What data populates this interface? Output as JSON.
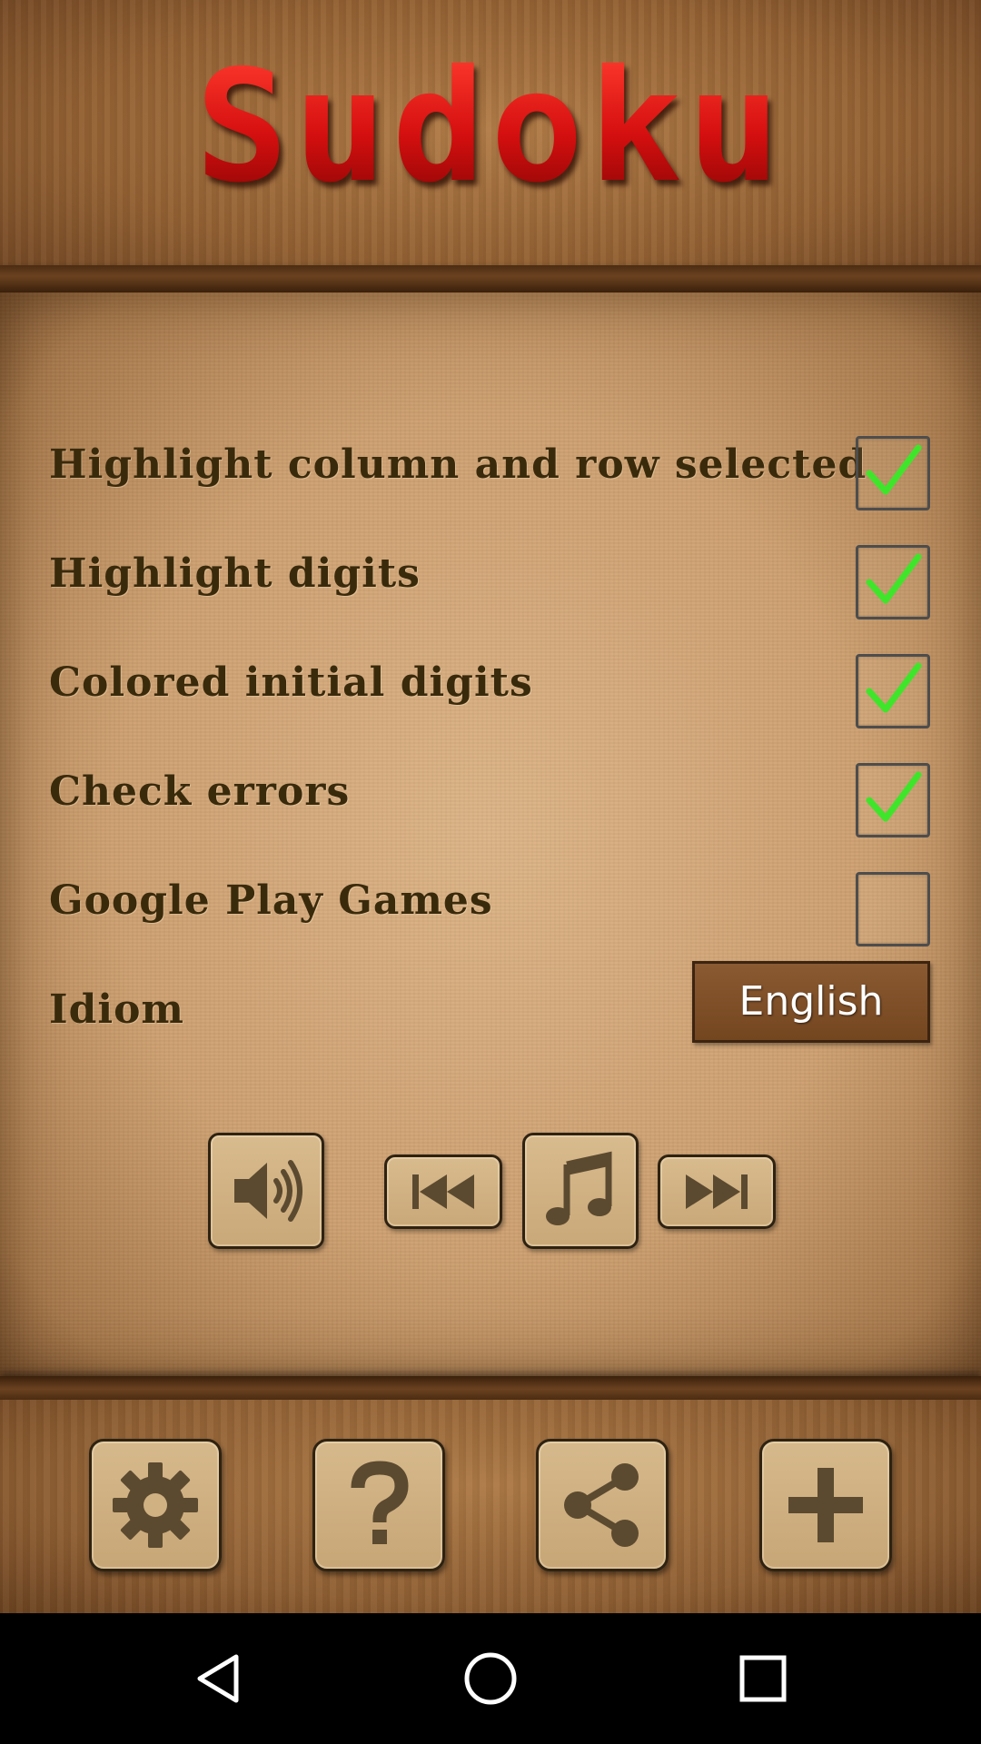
{
  "app": {
    "title": "Sudoku"
  },
  "settings": [
    {
      "label": "Highlight column and row selected",
      "checked": true
    },
    {
      "label": "Highlight digits",
      "checked": true
    },
    {
      "label": "Colored initial digits",
      "checked": true
    },
    {
      "label": "Check errors",
      "checked": true
    },
    {
      "label": "Google Play Games",
      "checked": false
    }
  ],
  "idiom": {
    "label": "Idiom",
    "value": "English"
  },
  "music_controls": {
    "icons": [
      "speaker-icon",
      "previous-track-icon",
      "music-note-icon",
      "next-track-icon"
    ]
  },
  "toolbar": {
    "icons": [
      "gear-icon",
      "help-icon",
      "share-icon",
      "plus-icon"
    ]
  },
  "navbar": {
    "icons": [
      "back-icon",
      "home-icon",
      "recents-icon"
    ]
  },
  "colors": {
    "title_red": "#e21b1b",
    "check_green": "#3fe52a",
    "label_brown": "#3a2a0c",
    "wood": "#936133",
    "parchment": "#cda070"
  }
}
